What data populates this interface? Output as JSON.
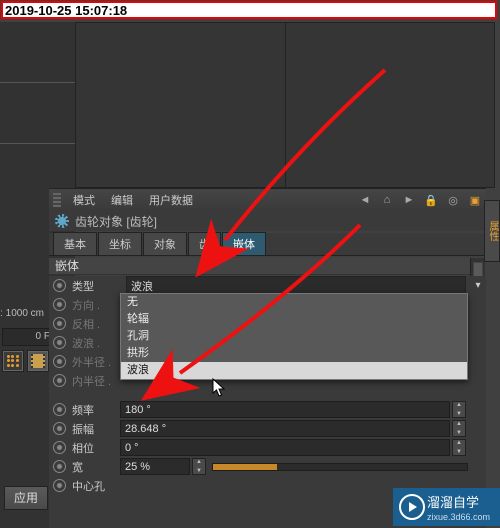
{
  "timestamp": "2019-10-25 15:07:18",
  "menu": {
    "mode": "模式",
    "edit": "编辑",
    "user_data": "用户数据"
  },
  "panel": {
    "title": "齿轮对象 [齿轮]",
    "tabs": [
      "基本",
      "坐标",
      "对象",
      "齿",
      "嵌体"
    ],
    "active_tab_index": 4,
    "section": "嵌体"
  },
  "attrs": {
    "type": {
      "label": "类型",
      "value": "波浪"
    },
    "dir": {
      "label": "方向 .",
      "options": [
        "无",
        "轮辐",
        "孔洞",
        "拱形",
        "波浪"
      ],
      "highlight_index": 4
    },
    "invert": {
      "label": "反相 ."
    },
    "wave": {
      "label": "波浪 ."
    },
    "outer_r": {
      "label": "外半径 ."
    },
    "inner_r": {
      "label": "内半径 ."
    },
    "freq": {
      "label": "频率",
      "value": "180 °"
    },
    "amp": {
      "label": "振幅",
      "value": "28.648 °"
    },
    "phase": {
      "label": "相位",
      "value": "0 °"
    },
    "width": {
      "label": "宽",
      "value": "25 %"
    },
    "center": {
      "label": "中心孔"
    }
  },
  "left": {
    "dist": ": 1000 cm",
    "frame": "0 F",
    "apply": "应用"
  },
  "side_tab": "属性",
  "watermark": {
    "title": "溜溜自学",
    "url": "zixue.3d66.com"
  }
}
